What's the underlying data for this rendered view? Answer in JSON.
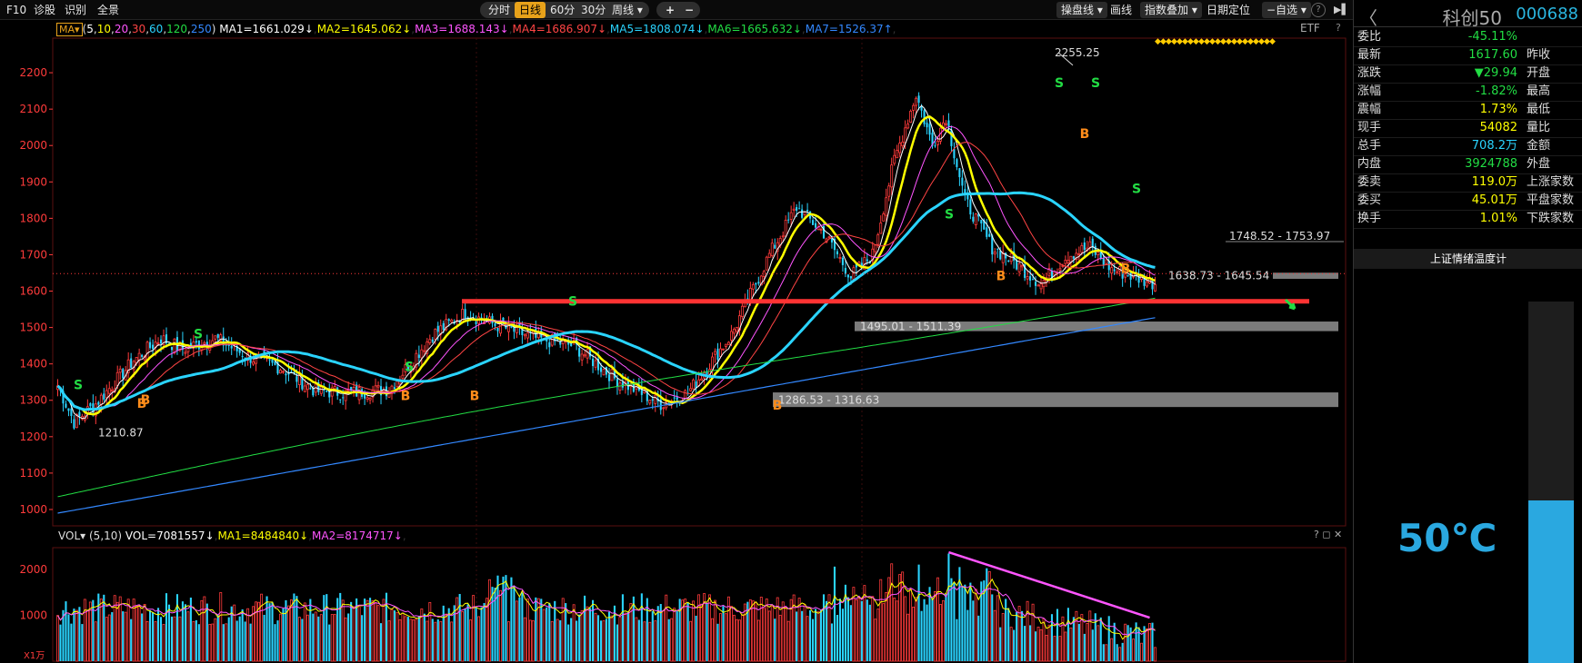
{
  "toolbar": {
    "left_items": [
      "F10",
      "诊股",
      "识别",
      "全景"
    ],
    "period_tabs": [
      "分时",
      "日线",
      "60分",
      "30分",
      "周线"
    ],
    "active_period": "日线",
    "zoom_in": "+",
    "zoom_out": "−",
    "right_items": [
      "操盘线",
      "画线",
      "指数叠加",
      "日期定位",
      "−自选"
    ],
    "help": "?",
    "collapse": "▶▌"
  },
  "ma_legend": {
    "label": "MA",
    "params_prefix": "(",
    "params": [
      "5",
      "10",
      "20",
      "30",
      "60",
      "120",
      "250"
    ],
    "params_suffix": ")",
    "items": [
      {
        "text": "MA1=1661.029",
        "arrow": "↓",
        "color": "#ffffff"
      },
      {
        "text": "MA2=1645.062",
        "arrow": "↓",
        "color": "#ffff00"
      },
      {
        "text": "MA3=1688.143",
        "arrow": "↓",
        "color": "#ff55ff"
      },
      {
        "text": "MA4=1686.907",
        "arrow": "↓",
        "color": "#ff4444"
      },
      {
        "text": "MA5=1808.074",
        "arrow": "↓",
        "color": "#2ad4ff"
      },
      {
        "text": "MA6=1665.632",
        "arrow": "↓",
        "color": "#22dd44"
      },
      {
        "text": "MA7=1526.37",
        "arrow": "↑",
        "color": "#3388ff"
      }
    ],
    "etf": "ETF",
    "help": "?"
  },
  "vol_legend": {
    "label": "VOL",
    "params": "(5,10)",
    "items": [
      {
        "text": "VOL=7081557",
        "arrow": "↓",
        "color": "#ffffff"
      },
      {
        "text": "MA1=8484840",
        "arrow": "↓",
        "color": "#ffff00"
      },
      {
        "text": "MA2=8174717",
        "arrow": "↓",
        "color": "#ff55ff"
      }
    ],
    "controls": "? ◻ ✕",
    "unit": "X1万"
  },
  "chart_data": {
    "type": "candlestick",
    "price_axis": {
      "ticks": [
        1000,
        1100,
        1200,
        1300,
        1400,
        1500,
        1600,
        1700,
        1800,
        1900,
        2000,
        2100,
        2200
      ],
      "range": [
        960,
        2290
      ]
    },
    "volume_axis": {
      "ticks": [
        1000,
        2000
      ],
      "range": [
        0,
        2400
      ],
      "unit": "X1万"
    },
    "annotations": [
      {
        "text": "2255.25",
        "price": 2255.25
      },
      {
        "text": "1210.87",
        "price": 1210.87
      },
      {
        "text": "1748.52 - 1753.97",
        "price": 1751
      },
      {
        "text": "1495.01 - 1511.39",
        "price": 1503
      },
      {
        "text": "1286.53 - 1316.63",
        "price": 1301
      },
      {
        "text": "1638.73 - 1645.54",
        "price": 1642
      }
    ],
    "support_line": {
      "price": 1572,
      "color": "#ff3333"
    },
    "zones": [
      {
        "low": 1495.01,
        "high": 1511.39
      },
      {
        "low": 1286.53,
        "high": 1316.63
      },
      {
        "low": 1638.73,
        "high": 1645.54
      }
    ],
    "signals": [
      {
        "type": "S",
        "price": 1330
      },
      {
        "type": "B",
        "price": 1290
      },
      {
        "type": "S",
        "price": 1470
      },
      {
        "type": "B",
        "price": 1280
      },
      {
        "type": "S",
        "price": 1380
      },
      {
        "type": "B",
        "price": 1300
      },
      {
        "type": "B",
        "price": 1300
      },
      {
        "type": "S",
        "price": 1560
      },
      {
        "type": "B",
        "price": 1275
      },
      {
        "type": "S",
        "price": 1800
      },
      {
        "type": "B",
        "price": 1630
      },
      {
        "type": "S",
        "price": 2160
      },
      {
        "type": "B",
        "price": 2020
      },
      {
        "type": "S",
        "price": 2160
      },
      {
        "type": "S",
        "price": 1870
      },
      {
        "type": "B",
        "price": 1650
      }
    ],
    "last_close": 1617.6
  },
  "panel": {
    "back": "〈",
    "name": "科创50",
    "code": "000688",
    "rows": [
      {
        "label": "委比",
        "value": "-45.11%",
        "color": "green",
        "label2": ""
      },
      {
        "label": "最新",
        "value": "1617.60",
        "color": "green",
        "label2": "昨收"
      },
      {
        "label": "涨跌",
        "value": "▼29.94",
        "color": "green",
        "label2": "开盘"
      },
      {
        "label": "涨幅",
        "value": "-1.82%",
        "color": "green",
        "label2": "最高"
      },
      {
        "label": "震幅",
        "value": "1.73%",
        "color": "yellow",
        "label2": "最低"
      },
      {
        "label": "现手",
        "value": "54082",
        "color": "yellow",
        "label2": "量比"
      },
      {
        "label": "总手",
        "value": "708.2万",
        "color": "cyan",
        "label2": "金额"
      },
      {
        "label": "内盘",
        "value": "3924788",
        "color": "green",
        "label2": "外盘"
      },
      {
        "label": "委卖",
        "value": "119.0万",
        "color": "yellow",
        "label2": "上涨家数"
      },
      {
        "label": "委买",
        "value": "45.01万",
        "color": "yellow",
        "label2": "平盘家数"
      },
      {
        "label": "换手",
        "value": "1.01%",
        "color": "yellow",
        "label2": "下跌家数"
      }
    ],
    "temp_title": "上证情绪温度计",
    "temp_label": "50℃",
    "temp_level": 0.5
  }
}
